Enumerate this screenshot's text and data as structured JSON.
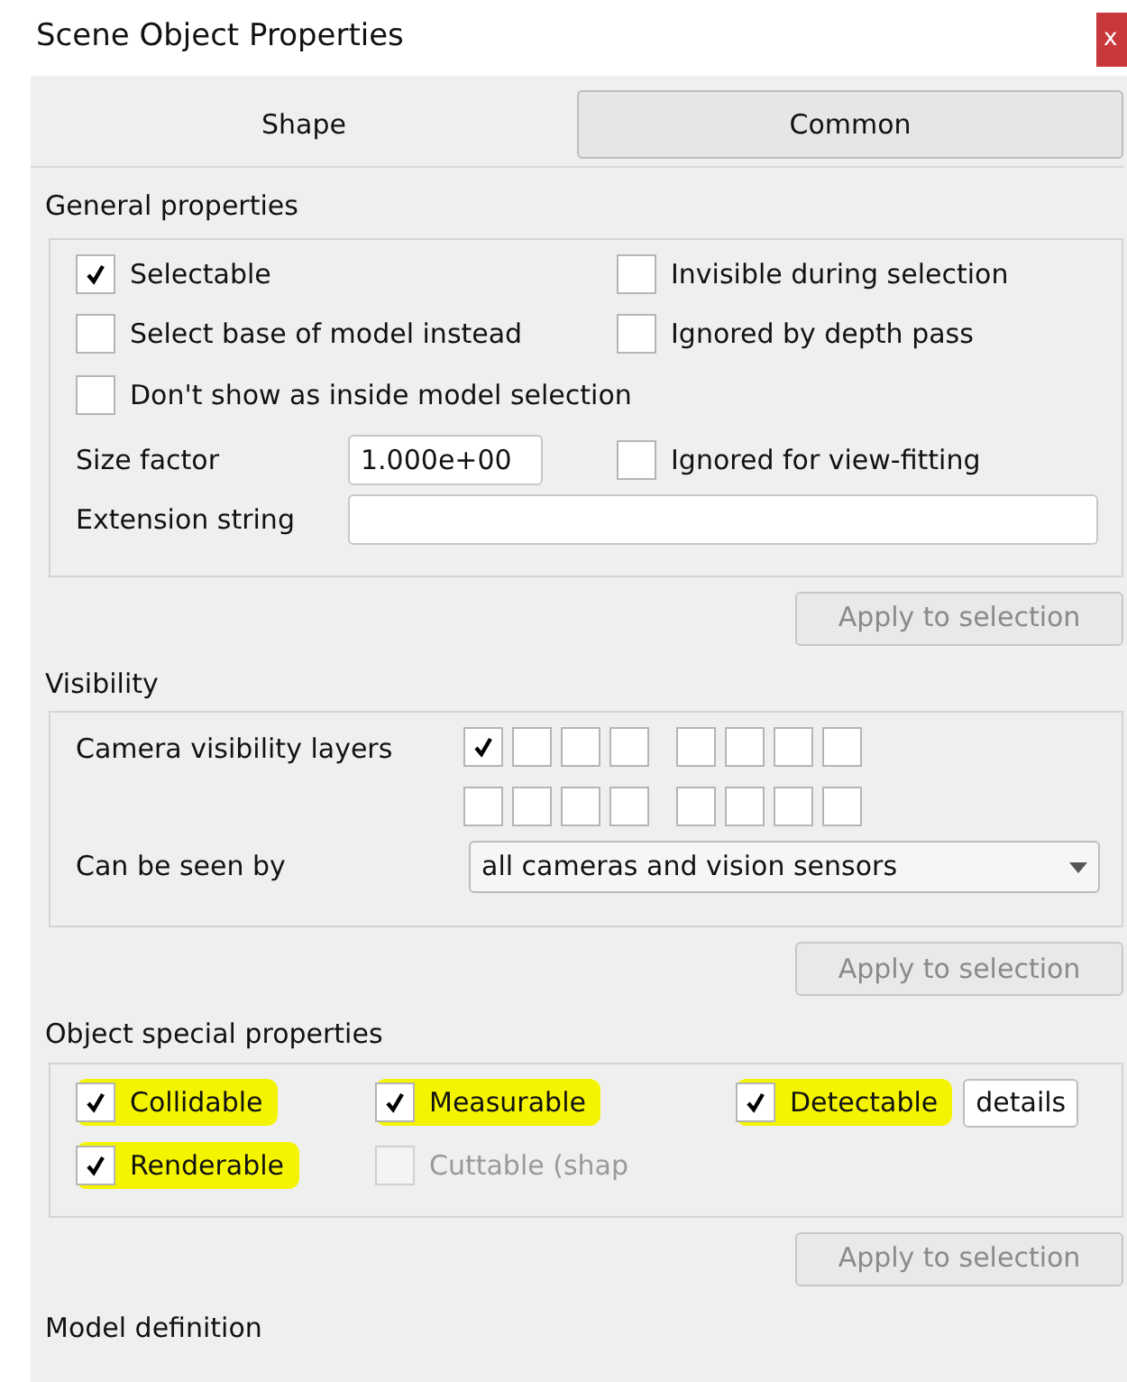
{
  "window": {
    "title": "Scene Object Properties",
    "close": "x"
  },
  "tabs": [
    {
      "label": "Shape",
      "selected": false
    },
    {
      "label": "Common",
      "selected": true
    }
  ],
  "general_properties": {
    "title": "General properties",
    "checkboxes": [
      {
        "label": "Selectable",
        "checked": true
      },
      {
        "label": "Invisible during selection",
        "checked": false
      },
      {
        "label": "Select base of model instead",
        "checked": false
      },
      {
        "label": "Ignored by depth pass",
        "checked": false
      },
      {
        "label": "Don't show as inside model selection",
        "checked": false
      },
      {
        "label": "Ignored for view-fitting",
        "checked": false
      }
    ],
    "size_factor": {
      "label": "Size factor",
      "value": "1.000e+00"
    },
    "extension_string": {
      "label": "Extension string"
    },
    "apply_button": {
      "label": "Apply to selection",
      "disabled": true
    }
  },
  "visibility": {
    "title": "Visibility",
    "layers_label": "Camera visibility layers",
    "layers": [
      {
        "checked": true
      },
      {
        "checked": false
      },
      {
        "checked": false
      },
      {
        "checked": false
      },
      {
        "checked": false
      },
      {
        "checked": false
      },
      {
        "checked": false
      },
      {
        "checked": false
      },
      {
        "checked": false
      },
      {
        "checked": false
      },
      {
        "checked": false
      },
      {
        "checked": false
      },
      {
        "checked": false
      },
      {
        "checked": false
      },
      {
        "checked": false
      },
      {
        "checked": false
      }
    ],
    "seen_by": {
      "label": "Can be seen by",
      "value": "all cameras and vision sensors"
    },
    "apply_button": {
      "label": "Apply to selection",
      "disabled": true
    }
  },
  "special_properties": {
    "title": "Object special properties",
    "checkboxes": [
      {
        "label": "Collidable",
        "checked": true,
        "disabled": false,
        "highlighted": true
      },
      {
        "label": "Measurable",
        "checked": true,
        "disabled": false,
        "highlighted": true
      },
      {
        "label": "Detectable",
        "checked": true,
        "disabled": false,
        "highlighted": true
      },
      {
        "label": "Renderable",
        "checked": true,
        "disabled": false,
        "highlighted": true
      },
      {
        "label": "Cuttable (shap",
        "checked": false,
        "disabled": true,
        "highlighted": false
      }
    ],
    "details_button": "details",
    "apply_button": {
      "label": "Apply to selection",
      "disabled": true
    }
  },
  "model_definition": {
    "title": "Model definition"
  }
}
